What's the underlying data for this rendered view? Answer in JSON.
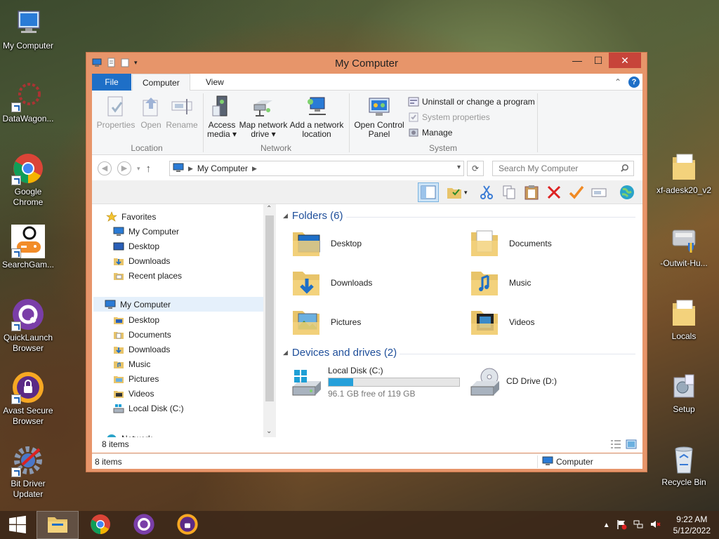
{
  "desktop": {
    "icons_left": [
      {
        "label": "My Computer"
      },
      {
        "label": "DataWagon..."
      },
      {
        "label": "Google Chrome"
      },
      {
        "label": "SearchGam..."
      },
      {
        "label": "QuickLaunch Browser"
      },
      {
        "label": "Avast Secure Browser"
      },
      {
        "label": "Bit Driver Updater"
      }
    ],
    "icons_right": [
      {
        "label": "xf-adesk20_v2"
      },
      {
        "label": "-Outwit-Hu..."
      },
      {
        "label": "Locals"
      },
      {
        "label": "Setup"
      },
      {
        "label": "Recycle Bin"
      }
    ]
  },
  "window": {
    "title": "My Computer",
    "controls": {
      "minimize": "—",
      "maximize": "☐",
      "close": "✕"
    },
    "ribbon_tabs": [
      {
        "label": "File"
      },
      {
        "label": "Computer"
      },
      {
        "label": "View"
      }
    ],
    "ribbon": {
      "location": {
        "label": "Location",
        "buttons": [
          {
            "label": "Properties"
          },
          {
            "label": "Open"
          },
          {
            "label": "Rename"
          }
        ]
      },
      "network": {
        "label": "Network",
        "buttons": [
          {
            "line1": "Access",
            "line2": "media ▾"
          },
          {
            "line1": "Map network",
            "line2": "drive ▾"
          },
          {
            "line1": "Add a network",
            "line2": "location"
          }
        ]
      },
      "system": {
        "label": "System",
        "open_control_panel": {
          "line1": "Open Control",
          "line2": "Panel"
        },
        "uninstall": "Uninstall or change a program",
        "system_properties": "System properties",
        "manage": "Manage"
      }
    },
    "address": {
      "path": "My Computer",
      "search_placeholder": "Search My Computer"
    },
    "nav_pane": {
      "favorites_header": "Favorites",
      "favorites": [
        "My Computer",
        "Desktop",
        "Downloads",
        "Recent places"
      ],
      "computer_header": "My Computer",
      "computer_items": [
        "Desktop",
        "Documents",
        "Downloads",
        "Music",
        "Pictures",
        "Videos",
        "Local Disk (C:)"
      ],
      "network_partial": "Network"
    },
    "folders_header": "Folders (6)",
    "folders": [
      {
        "name": "Desktop"
      },
      {
        "name": "Documents"
      },
      {
        "name": "Downloads"
      },
      {
        "name": "Music"
      },
      {
        "name": "Pictures"
      },
      {
        "name": "Videos"
      }
    ],
    "drives_header": "Devices and drives (2)",
    "drives": {
      "c": {
        "name": "Local Disk (C:)",
        "free_text": "96.1 GB free of 119 GB",
        "used_fraction": 0.19
      },
      "d": {
        "name": "CD Drive (D:)"
      }
    },
    "status": {
      "items_top": "8 items",
      "items_bottom": "8 items",
      "location": "Computer"
    }
  },
  "taskbar": {
    "clock": {
      "time": "9:22 AM",
      "date": "5/12/2022"
    }
  },
  "colors": {
    "accent": "#1e6fc7",
    "window_border": "#e7956a",
    "close": "#c7443a",
    "link": "#1e4e9a",
    "bar_fill": "#26a0da"
  }
}
